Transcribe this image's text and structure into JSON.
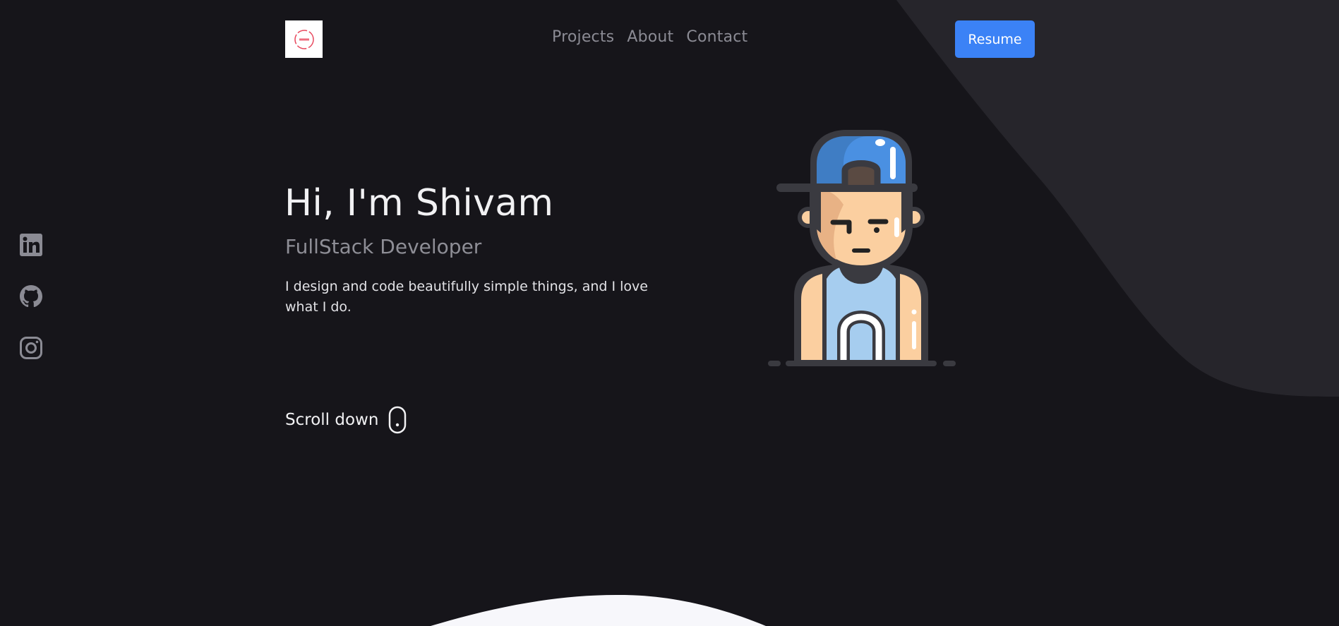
{
  "header": {
    "logo_alt": "logo",
    "nav": [
      {
        "label": "Projects"
      },
      {
        "label": "About"
      },
      {
        "label": "Contact"
      }
    ],
    "resume_label": "Resume"
  },
  "social": [
    {
      "icon": "linkedin-icon"
    },
    {
      "icon": "github-icon"
    },
    {
      "icon": "instagram-icon"
    }
  ],
  "hero": {
    "title": "Hi, I'm Shivam",
    "subtitle": "FullStack Developer",
    "description": "I design and code beautifully simple things, and I love what I do.",
    "scroll_label": "Scroll down"
  },
  "colors": {
    "background": "#16151a",
    "accent_shape": "#26252b",
    "button": "#3b82f6",
    "nav_text": "#8b8b94",
    "bottom_wave": "#f7f7fb"
  }
}
